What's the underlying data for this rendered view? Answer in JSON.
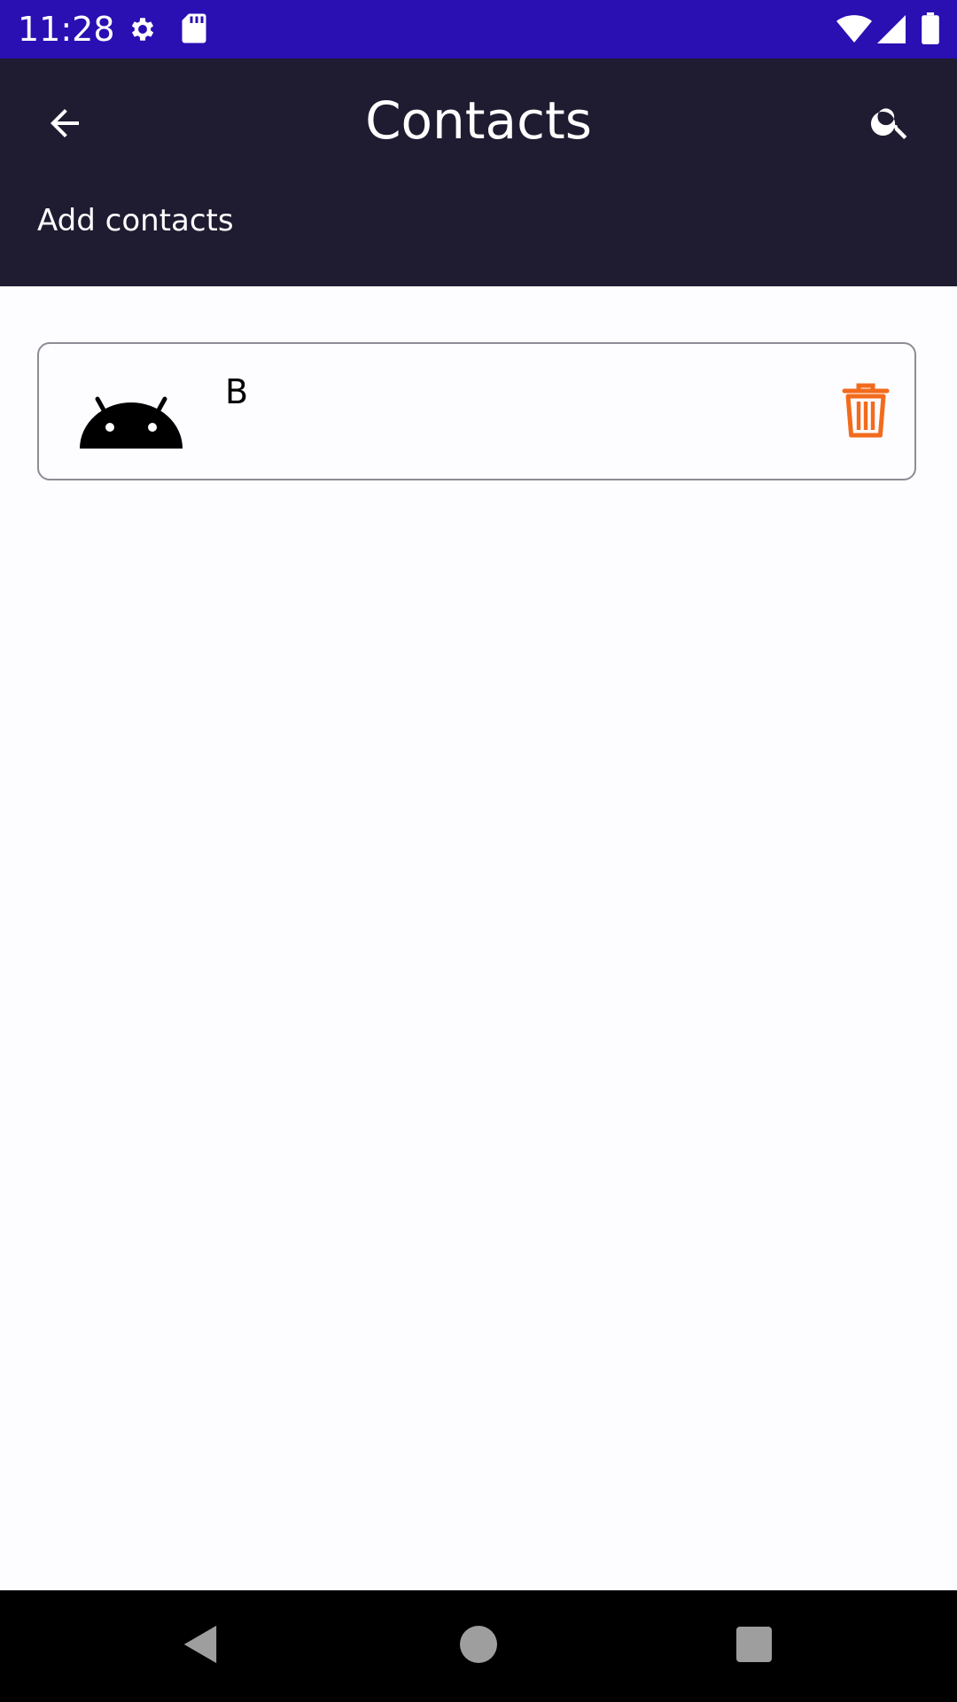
{
  "status_bar": {
    "time": "11:28",
    "icons": [
      "settings-icon",
      "sd-card-icon",
      "wifi-icon",
      "signal-icon",
      "battery-icon"
    ]
  },
  "app_bar": {
    "title": "Contacts",
    "subtitle_link": "Add contacts",
    "back_icon": "arrow-back-icon",
    "search_icon": "search-icon"
  },
  "contacts": [
    {
      "name": "B",
      "avatar_icon": "android-icon",
      "delete_icon": "trash-icon"
    }
  ],
  "nav_bar": {
    "buttons": [
      "back-triangle-icon",
      "home-circle-icon",
      "recents-square-icon"
    ]
  },
  "colors": {
    "status_bar": "#2a0fb3",
    "app_bar": "#1f1b31",
    "background": "#fdfcff",
    "delete_accent": "#f26b1d",
    "nav_bar": "#000000"
  }
}
